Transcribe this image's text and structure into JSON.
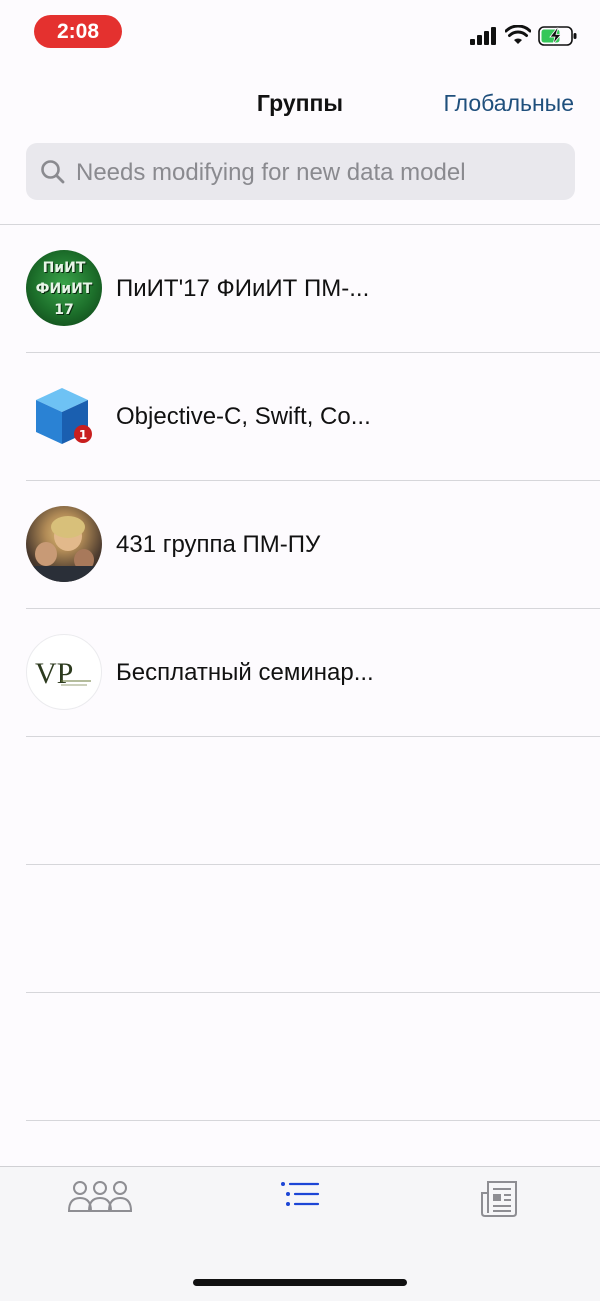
{
  "status_bar": {
    "time": "2:08",
    "time_pill_color": "#e4312f",
    "signal_icon": "cellular-signal-icon",
    "wifi_icon": "wifi-icon",
    "battery_icon": "battery-charging-icon"
  },
  "nav": {
    "title": "Группы",
    "right_button": "Глобальные",
    "accent_color": "#1f4f7c"
  },
  "search": {
    "placeholder": "Needs modifying for new data model",
    "icon": "search-icon"
  },
  "groups": [
    {
      "title": "ПиИТ'17 ФИиИТ ПМ-...",
      "avatar": "piit-logo-avatar",
      "avatar_text": [
        "ПиИТ",
        "ФИиИТ",
        "17"
      ]
    },
    {
      "title": "Objective-C, Swift, Co...",
      "avatar": "blue-cube-avatar",
      "badge": "1"
    },
    {
      "title": "431 группа ПМ-ПУ",
      "avatar": "group-photo-avatar"
    },
    {
      "title": "Бесплатный семинар...",
      "avatar": "vp-logo-avatar",
      "avatar_text": "VP"
    }
  ],
  "tab_bar": {
    "tabs": [
      {
        "name": "people-tab",
        "icon": "people-icon",
        "active": false
      },
      {
        "name": "list-tab",
        "icon": "list-icon",
        "active": true
      },
      {
        "name": "news-tab",
        "icon": "newspaper-icon",
        "active": false
      }
    ],
    "active_color": "#1d46d6",
    "inactive_color": "#8e8e93"
  }
}
